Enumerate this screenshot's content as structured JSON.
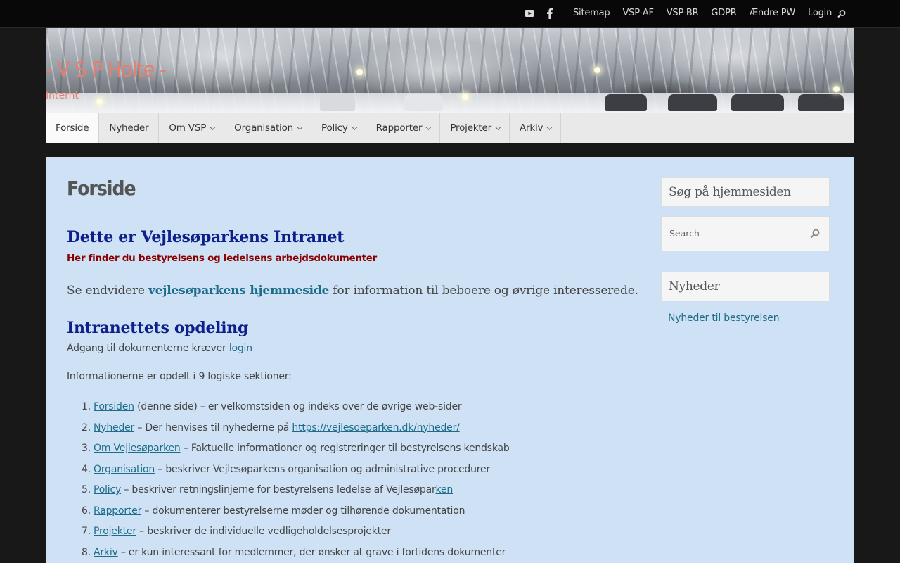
{
  "topbar": {
    "social": [
      {
        "icon": "youtube-icon"
      },
      {
        "icon": "facebook-icon"
      }
    ],
    "links": [
      "Sitemap",
      "VSP-AF",
      "VSP-BR",
      "GDPR",
      "Ændre PW",
      "Login"
    ],
    "search_icon": "search-icon"
  },
  "header": {
    "title": "- V S P Holte -",
    "tagline": "Internt"
  },
  "mainnav": {
    "items": [
      {
        "label": "Forside",
        "dropdown": false,
        "active": true
      },
      {
        "label": "Nyheder",
        "dropdown": false
      },
      {
        "label": "Om VSP",
        "dropdown": true
      },
      {
        "label": "Organisation",
        "dropdown": true
      },
      {
        "label": "Policy",
        "dropdown": true
      },
      {
        "label": "Rapporter",
        "dropdown": true
      },
      {
        "label": "Projekter",
        "dropdown": true
      },
      {
        "label": "Arkiv",
        "dropdown": true
      }
    ]
  },
  "main": {
    "page_title": "Forside",
    "heading_intranet": "Dette er Vejlesøparkens Intranet",
    "subheading": "Her finder du bestyrelsens og ledelsens arbejdsdokumenter",
    "also_prefix": "Se endvidere ",
    "also_link": "vejlesøparkens hjemmeside",
    "also_suffix": " for information til beboere og øvrige interesserede.",
    "heading_opdeling": "Intranettets opdeling",
    "access_text": "Adgang til dokumenterne kræver ",
    "access_link": "login",
    "info_text": "Informationerne er opdelt i 9 logiske sektioner:",
    "sections": [
      {
        "num": "1.",
        "link": "Forsiden",
        "text": " (denne side) – er velkomstsiden og indeks over de øvrige web-sider",
        "link2": "",
        "text2": ""
      },
      {
        "num": "2.",
        "link": "Nyheder",
        "text": " – Der henvises til nyhederne på ",
        "link2": "https://vejlesoeparken.dk/nyheder/",
        "text2": ""
      },
      {
        "num": "3.",
        "link": "Om Vejlesøparken",
        "text": " – Faktuelle informationer og registreringer til bestyrelsens kendskab",
        "link2": "",
        "text2": ""
      },
      {
        "num": "4.",
        "link": "Organisation",
        "text": " – beskriver Vejlesøparkens organisation og administrative procedurer",
        "link2": "",
        "text2": ""
      },
      {
        "num": "5.",
        "link": "Policy",
        "text": " – beskriver retningslinjerne for bestyrelsens ledelse af Vejlesøpar",
        "link2": "ken",
        "text2": ""
      },
      {
        "num": "6.",
        "link": "Rapporter",
        "text": " – dokumenterer bestyrelserne møder og tilhørende dokumentation",
        "link2": "",
        "text2": ""
      },
      {
        "num": "7.",
        "link": "Projekter",
        "text": " – beskriver de individuelle vedligeholdelsesprojekter",
        "link2": "",
        "text2": ""
      },
      {
        "num": "8.",
        "link": "Arkiv",
        "text": " – er kun interessant for medlemmer, der ønsker at grave i fortidens dokumenter",
        "link2": "",
        "text2": ""
      }
    ]
  },
  "sidebar": {
    "search_heading": "Søg på hjemmesiden",
    "search_placeholder": "Search",
    "news_heading": "Nyheder",
    "news_link": "Nyheder til bestyrelsen"
  },
  "colors": {
    "title_accent": "#e77f6f",
    "heading_blue": "#0d1f8a",
    "subheading_red": "#8b0000",
    "link": "#1d6c89",
    "content_bg": "#cfe2f5"
  }
}
